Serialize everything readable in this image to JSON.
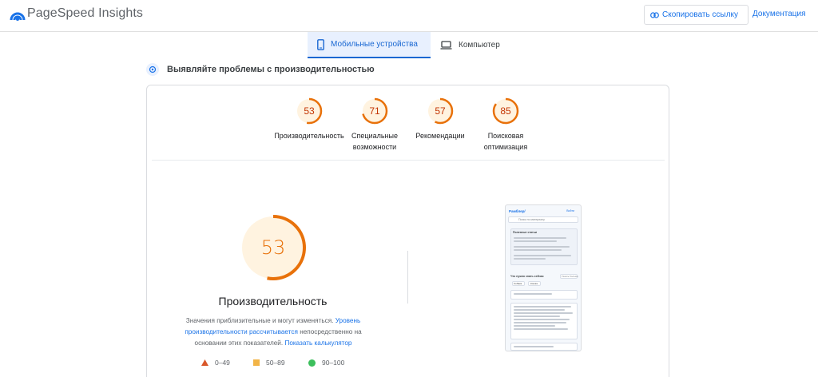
{
  "header": {
    "app_title": "PageSpeed Insights",
    "copy_link_label": "Скопировать ссылку",
    "docs_label": "Документация"
  },
  "tabs": [
    {
      "label": "Мобильные устройства",
      "active": true,
      "icon": "phone-icon"
    },
    {
      "label": "Компьютер",
      "active": false,
      "icon": "laptop-icon"
    }
  ],
  "section": {
    "title": "Выявляйте проблемы с производительностью",
    "icon": "speed-icon"
  },
  "scores": [
    {
      "value": "53",
      "label_lines": [
        "Производительность"
      ]
    },
    {
      "value": "71",
      "label_lines": [
        "Специальные",
        "возможности"
      ]
    },
    {
      "value": "57",
      "label_lines": [
        "Рекомендации"
      ]
    },
    {
      "value": "85",
      "label_lines": [
        "Поисковая",
        "оптимизация"
      ]
    }
  ],
  "main_score": {
    "value": "53",
    "fraction": 0.53,
    "title": "Производительность",
    "note_prefix": "Значения приблизительные и могут изменяться.",
    "note_link1": "Уровень производительности рассчитывается",
    "note_middle": "непосредственно на основании этих показателей.",
    "note_link2": "Показать калькулятор"
  },
  "legend": [
    {
      "range": "0–49",
      "shape": "triangle",
      "color": "#d9582b"
    },
    {
      "range": "50–89",
      "shape": "square",
      "color": "#f2b447"
    },
    {
      "range": "90–100",
      "shape": "circle",
      "color": "#3cbf5c"
    }
  ],
  "colors": {
    "accent": "#1a73e8",
    "average": "#e8710a",
    "average_fill": "#fff3e0",
    "fail": "#d9582b"
  },
  "preview": {
    "brand": "Рамблер/",
    "top_right": "Войти",
    "search_hint": "Поиск по материалу",
    "box_title": "Полезные статьи",
    "section_title": "Что нужно знать сейчас",
    "chip1": "Собака",
    "chip2": "Кошка",
    "more": "Узнать больше"
  }
}
